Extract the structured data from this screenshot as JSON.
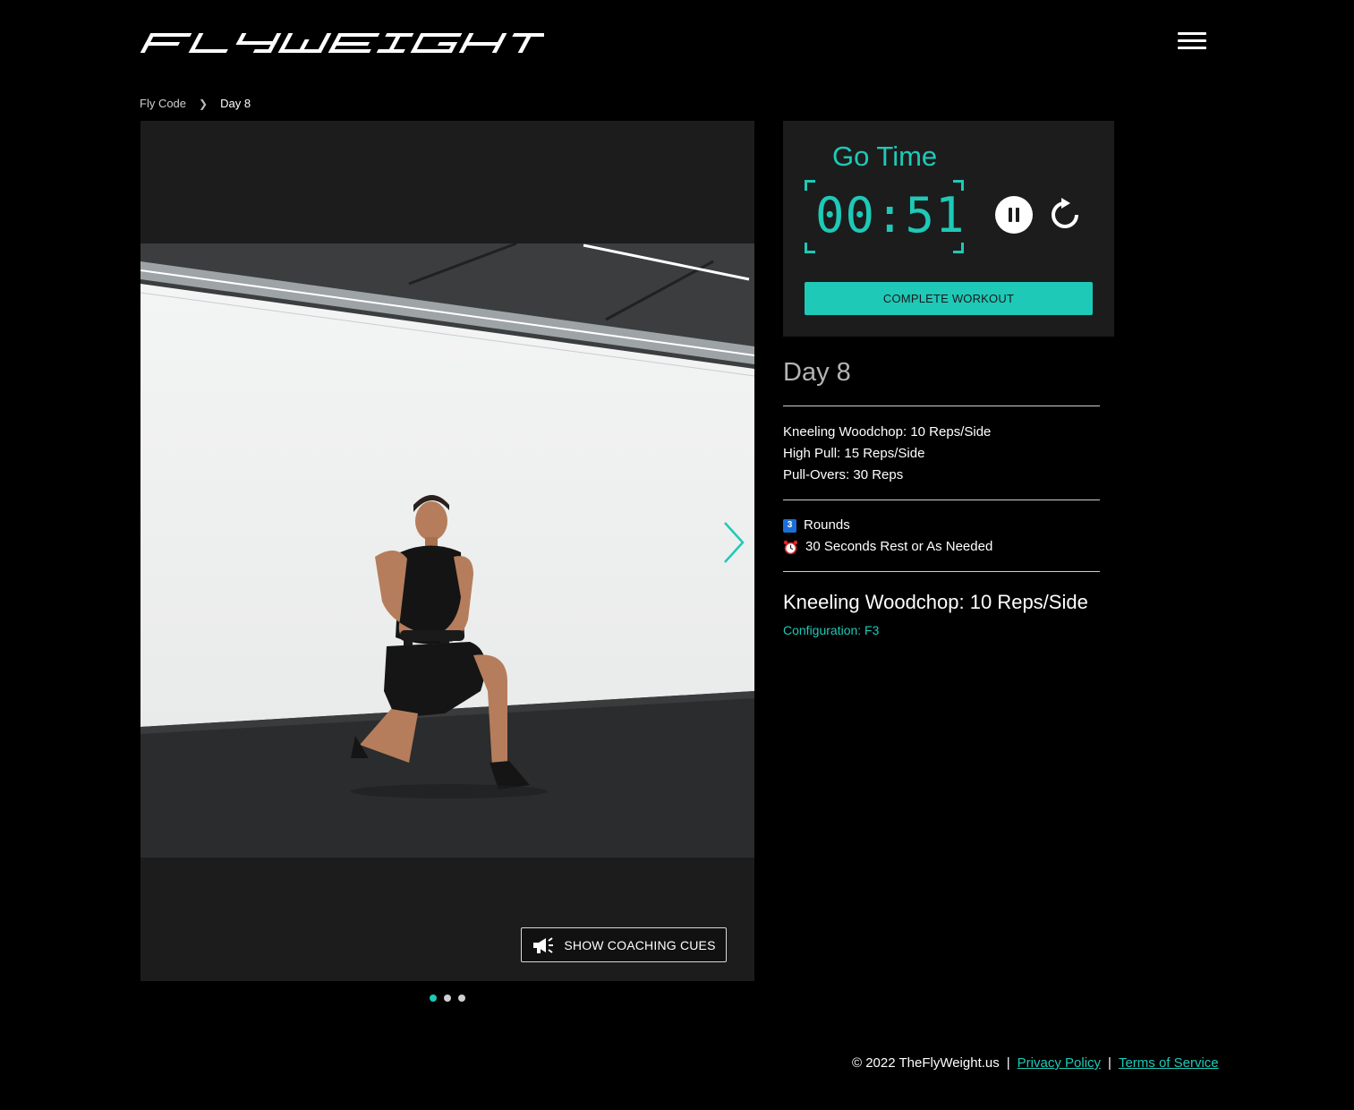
{
  "brand": {
    "logo_text": "FLYWEIGHT",
    "accent_color": "#1ec9b7",
    "background": "#000000",
    "panel_color": "#1c1c1c"
  },
  "header": {
    "menu_icon": "hamburger-menu-icon"
  },
  "breadcrumb": {
    "parent": "Fly Code",
    "separator_icon": "chevron-right-icon",
    "current": "Day 8"
  },
  "media": {
    "next_icon": "chevron-right-icon",
    "coaching_button": {
      "icon": "megaphone-icon",
      "label": "SHOW COACHING CUES"
    },
    "carousel": {
      "count": 3,
      "active_index": 0
    }
  },
  "timer": {
    "title": "Go Time",
    "time": "00:51",
    "pause_icon": "pause-icon",
    "reset_icon": "reset-icon",
    "complete_label": "COMPLETE WORKOUT"
  },
  "workout": {
    "day_title": "Day 8",
    "exercises": [
      "Kneeling Woodchop: 10 Reps/Side",
      "High Pull: 15 Reps/Side",
      "Pull-Overs: 30 Reps"
    ],
    "rounds_badge": "3",
    "rounds_label": "Rounds",
    "rest_icon": "alarm-clock-icon",
    "rest_label": "30 Seconds Rest or As Needed",
    "current_exercise": "Kneeling Woodchop: 10 Reps/Side",
    "configuration": "Configuration: F3"
  },
  "footer": {
    "copyright": "© 2022 TheFlyWeight.us",
    "separator": "|",
    "privacy_label": "Privacy Policy",
    "terms_label": "Terms of Service"
  }
}
